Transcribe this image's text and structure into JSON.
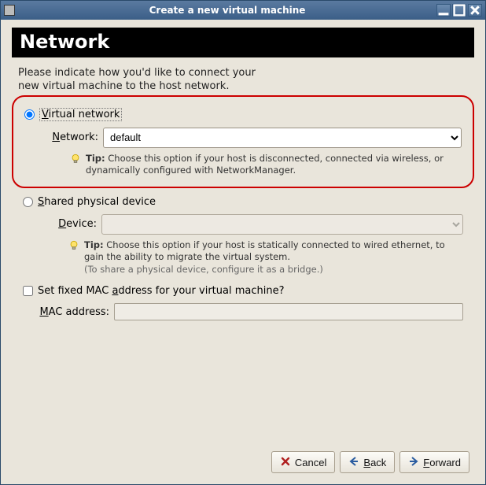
{
  "window": {
    "title": "Create a new virtual machine"
  },
  "header": "Network",
  "intro": {
    "line1": "Please indicate how you'd like to connect your",
    "line2": "new virtual machine to the host network."
  },
  "virtual_network": {
    "radio_label": "Virtual network",
    "network_label": "Network:",
    "selected": "default",
    "options": [
      "default"
    ],
    "tip_label": "Tip:",
    "tip_text": "Choose this option if your host is disconnected, connected via wireless, or dynamically configured with NetworkManager."
  },
  "shared_device": {
    "radio_label": "Shared physical device",
    "device_label": "Device:",
    "selected": "",
    "options": [],
    "tip_label": "Tip:",
    "tip_line1": "Choose this option if your host is statically connected to wired ethernet, to gain the ability to migrate the virtual system.",
    "tip_line2": "(To share a physical device, configure it as a bridge.)"
  },
  "mac": {
    "check_label": "Set fixed MAC address for your virtual machine?",
    "field_label": "MAC address:",
    "value": ""
  },
  "buttons": {
    "cancel": "Cancel",
    "back": "Back",
    "forward": "Forward"
  }
}
